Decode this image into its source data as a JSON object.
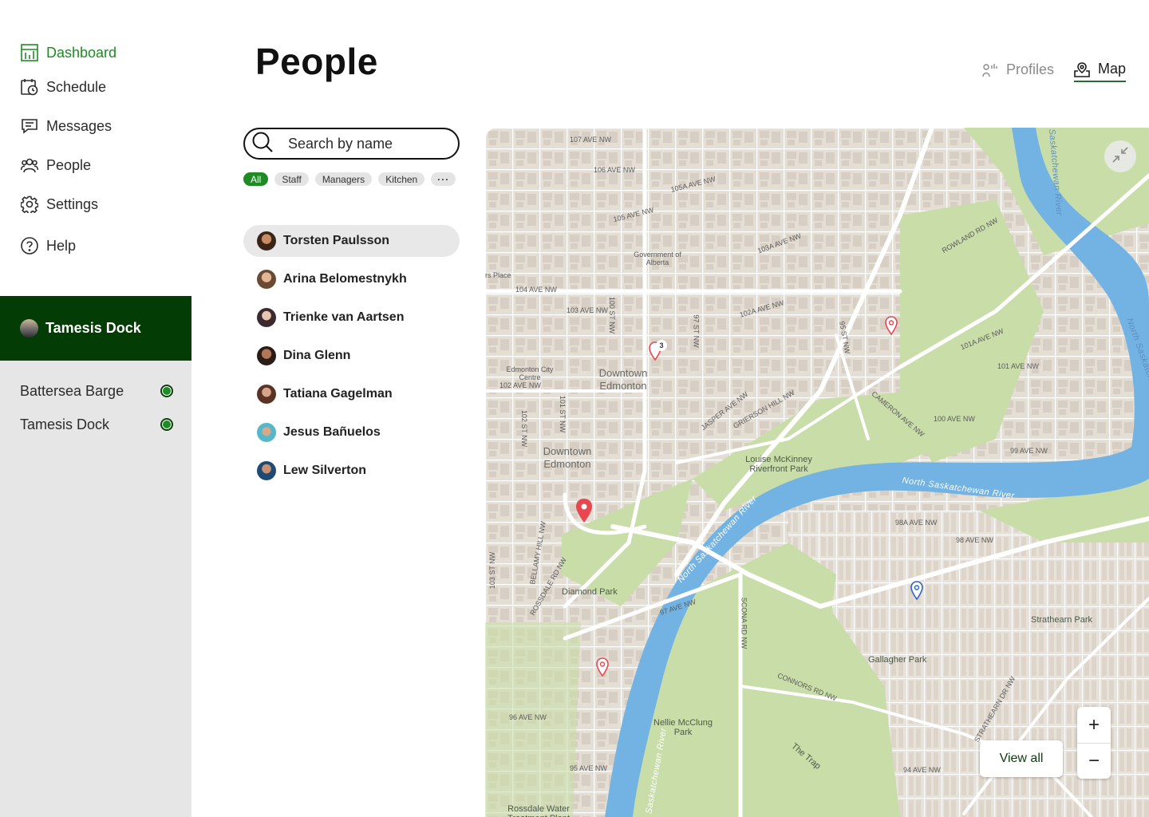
{
  "sidebar": {
    "nav": [
      {
        "label": "Dashboard",
        "icon": "dashboard-icon",
        "active": true
      },
      {
        "label": "Schedule",
        "icon": "calendar-clock-icon"
      },
      {
        "label": "Messages",
        "icon": "message-icon"
      },
      {
        "label": "People",
        "icon": "people-icon"
      },
      {
        "label": "Settings",
        "icon": "gear-icon"
      },
      {
        "label": "Help",
        "icon": "help-icon"
      }
    ],
    "current_venue": "Tamesis Dock",
    "venues": [
      {
        "label": "Battersea Barge",
        "status": "online"
      },
      {
        "label": "Tamesis Dock",
        "status": "online"
      }
    ]
  },
  "header": {
    "title": "People",
    "tabs": [
      {
        "label": "Profiles",
        "icon": "profiles-icon",
        "active": false
      },
      {
        "label": "Map",
        "icon": "map-pin-icon",
        "active": true
      }
    ]
  },
  "search": {
    "placeholder": "Search by name"
  },
  "filters": [
    "All",
    "Staff",
    "Managers",
    "Kitchen",
    "···"
  ],
  "people": [
    {
      "name": "Torsten Paulsson",
      "selected": true
    },
    {
      "name": "Arina Belomestnykh"
    },
    {
      "name": "Trienke van Aartsen"
    },
    {
      "name": "Dina Glenn"
    },
    {
      "name": "Tatiana Gagelman"
    },
    {
      "name": "Jesus Bañuelos"
    },
    {
      "name": "Lew Silverton"
    }
  ],
  "map": {
    "labels": {
      "downtown_1": "Downtown Edmonton",
      "downtown_2": "Downtown Edmonton",
      "gov": "Government of Alberta",
      "city_centre": "Edmonton City Centre",
      "louise": "Louise McKinney Riverfront Park",
      "diamond": "Diamond Park",
      "gallagher": "Gallagher Park",
      "strathearn": "Strathearn Park",
      "nellie": "Nellie McClung Park",
      "trap": "The Trap",
      "rossdale": "Rossdale Water Treatment Plant",
      "rs_place": "rs Place",
      "river_1": "North Saskatchewan River",
      "river_2": "North Saskatchewan River",
      "river_3": "North Saskatchewan River",
      "river_4": "Saskatchewan River",
      "river_5": "Saskatchewan River",
      "ave104": "104 AVE NW",
      "ave103": "103 AVE NW",
      "ave102a": "102A AVE NW",
      "ave102": "102 AVE NW",
      "ave107": "107 AVE NW",
      "ave106": "106 AVE NW",
      "ave105": "105 AVE NW",
      "ave105a": "105A AVE NW",
      "ave103a": "103A AVE NW",
      "ave101a": "101A AVE NW",
      "ave101": "101 AVE NW",
      "ave100": "100 AVE NW",
      "ave99": "99 AVE NW",
      "ave98": "98 AVE NW",
      "ave98a": "98A AVE NW",
      "ave97": "97 AVE NW",
      "ave96": "96 AVE NW",
      "ave95": "95 AVE NW",
      "ave94": "94 AVE NW",
      "jasper": "JASPER AVE NW",
      "grierson": "GRIERSON HILL NW",
      "cameron": "CAMERON AVE NW",
      "rowland": "ROWLAND RD NW",
      "connors": "CONNORS RD NW",
      "scona": "SCONA RD NW",
      "bellamy": "BELLAMY HILL NW",
      "rossdale_rd": "ROSSDALE RD NW",
      "strathearn_dr": "STRATHEARN DR NW",
      "st97": "97 ST NW",
      "st95": "95 ST NW",
      "st101": "101 ST NW",
      "st100": "100 ST NW",
      "st102": "102 ST NW",
      "st103": "103 ST NW",
      "cluster_count": "3"
    },
    "controls": {
      "zoom_in": "+",
      "zoom_out": "−",
      "view_all": "View all"
    },
    "colors": {
      "water": "#72b3e3",
      "park": "#c9dda9",
      "road": "#ffffff",
      "block": "#ddd5cb",
      "pin": "#e8474f",
      "pin_blue": "#2c63c9"
    }
  }
}
